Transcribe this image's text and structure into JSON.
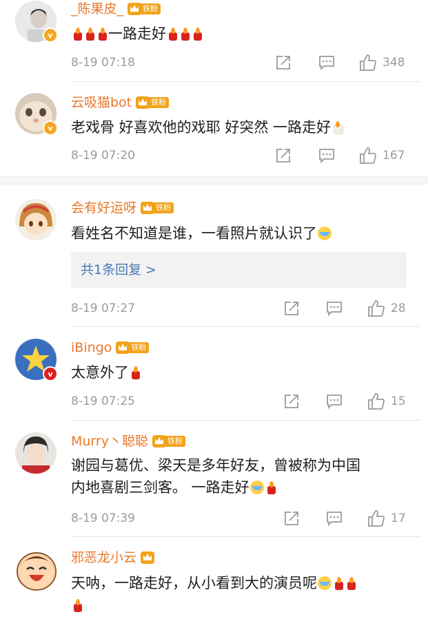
{
  "comments": [
    {
      "username": "_陈果皮_",
      "fan_badge": "铁粉",
      "text": "一路走好",
      "time": "8-19 07:18",
      "likes": "348"
    },
    {
      "username": "云吸猫bot",
      "fan_badge": "铁粉",
      "text": "老戏骨 好喜欢他的戏耶 好突然 一路走好",
      "time": "8-19 07:20",
      "likes": "167"
    },
    {
      "username": "会有好运呀",
      "fan_badge": "铁粉",
      "text": "看姓名不知道是谁，一看照片就认识了",
      "replies_label": "共1条回复 >",
      "time": "8-19 07:27",
      "likes": "28"
    },
    {
      "username": "iBingo",
      "fan_badge": "铁粉",
      "text": "太意外了",
      "time": "8-19 07:25",
      "likes": "15"
    },
    {
      "username": "Murry丶聪聪",
      "fan_badge": "铁粉",
      "text_line1": "谢园与葛优、梁天是多年好友，曾被称为中国",
      "text_line2": "内地喜剧三剑客。 一路走好",
      "time": "8-19 07:39",
      "likes": "17"
    },
    {
      "username": "邪恶龙小云",
      "text": "天呐，一路走好，从小看到大的演员呢",
      "time": "",
      "likes": ""
    }
  ],
  "verified_mark": "v",
  "colors": {
    "username": "#e8782a",
    "time": "#9a9a9a",
    "reply_link": "#4a78b4",
    "fan_badge": "#f2a21b"
  }
}
